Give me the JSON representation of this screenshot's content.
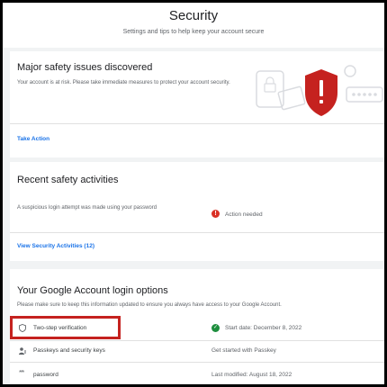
{
  "header": {
    "title": "Security",
    "subtitle": "Settings and tips to help keep your account secure"
  },
  "safety_issues": {
    "title": "Major safety issues discovered",
    "description": "Your account is at risk. Please take immediate measures to protect your account security.",
    "action_label": "Take Action"
  },
  "recent_activity": {
    "title": "Recent safety activities",
    "item_text": "A suspicious login attempt was made using your password",
    "item_status": "Action needed",
    "link_label": "View Security Activities (12)"
  },
  "login_options": {
    "title": "Your Google Account login options",
    "description": "Please make sure to keep this information updated to ensure you always have access to your Google Account.",
    "rows": [
      {
        "label": "Two-step verification",
        "status": "Start date: December 8, 2022",
        "icon": "shield-icon",
        "status_icon": "check-icon"
      },
      {
        "label": "Passkeys and security keys",
        "status": "Get started with Passkey",
        "icon": "person-key-icon"
      },
      {
        "label": "password",
        "status": "Last modified: August 18, 2022",
        "icon": "asterisk-icon"
      }
    ]
  },
  "colors": {
    "danger": "#d93025",
    "success": "#1e8e3e",
    "link": "#1a73e8",
    "highlight": "#c5221f"
  }
}
